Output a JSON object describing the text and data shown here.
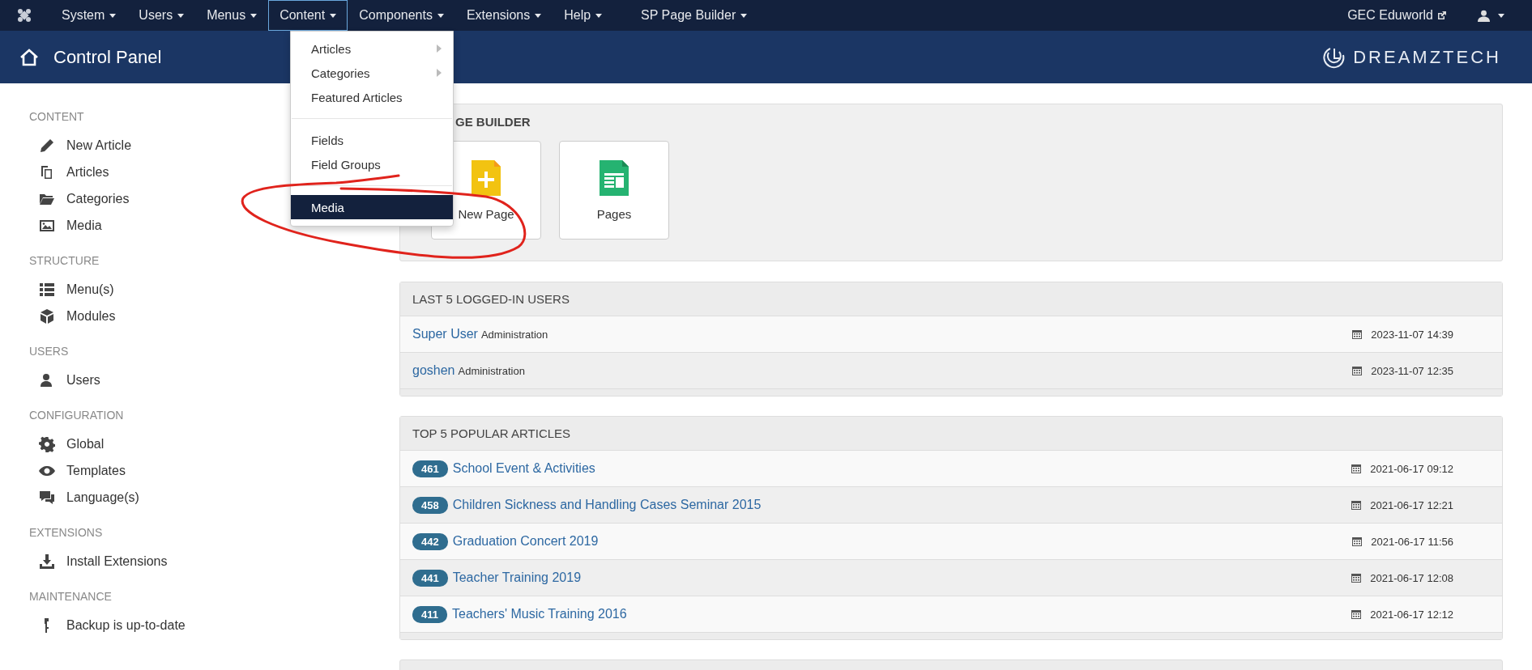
{
  "topbar": {
    "menus": [
      {
        "label": "System",
        "selected": false
      },
      {
        "label": "Users",
        "selected": false
      },
      {
        "label": "Menus",
        "selected": false
      },
      {
        "label": "Content",
        "selected": true
      },
      {
        "label": "Components",
        "selected": false
      },
      {
        "label": "Extensions",
        "selected": false
      },
      {
        "label": "Help",
        "selected": false
      },
      {
        "label": "SP Page Builder",
        "selected": false
      }
    ],
    "site_link": "GEC Eduworld"
  },
  "dropdown": {
    "items": [
      {
        "kind": "item",
        "label": "Articles",
        "submenu": true,
        "selected": false
      },
      {
        "kind": "item",
        "label": "Categories",
        "submenu": true,
        "selected": false
      },
      {
        "kind": "item",
        "label": "Featured Articles",
        "submenu": false,
        "selected": false
      },
      {
        "kind": "divider"
      },
      {
        "kind": "item",
        "label": "Fields",
        "submenu": false,
        "selected": false
      },
      {
        "kind": "item",
        "label": "Field Groups",
        "submenu": false,
        "selected": false
      },
      {
        "kind": "divider"
      },
      {
        "kind": "item",
        "label": "Media",
        "submenu": false,
        "selected": true
      }
    ]
  },
  "header": {
    "title": "Control Panel",
    "brand": "DREAMZTECH"
  },
  "sidebar": {
    "sections": [
      {
        "title": "CONTENT",
        "items": [
          "New Article",
          "Articles",
          "Categories",
          "Media"
        ]
      },
      {
        "title": "STRUCTURE",
        "items": [
          "Menu(s)",
          "Modules"
        ]
      },
      {
        "title": "USERS",
        "items": [
          "Users"
        ]
      },
      {
        "title": "CONFIGURATION",
        "items": [
          "Global",
          "Templates",
          "Language(s)"
        ]
      },
      {
        "title": "EXTENSIONS",
        "items": [
          "Install Extensions"
        ]
      },
      {
        "title": "MAINTENANCE",
        "items": [
          "Backup is up-to-date"
        ]
      }
    ]
  },
  "page_builder": {
    "title": "GE BUILDER",
    "tiles": [
      "New Page",
      "Pages"
    ]
  },
  "logged_in_users": {
    "title": "LAST 5 LOGGED-IN USERS",
    "rows": [
      {
        "name": "Super User",
        "role": "Administration",
        "date": "2023-11-07 14:39"
      },
      {
        "name": "goshen",
        "role": "Administration",
        "date": "2023-11-07 12:35"
      }
    ]
  },
  "popular_articles": {
    "title": "TOP 5 POPULAR ARTICLES",
    "rows": [
      {
        "hits": "461",
        "title": "School Event & Activities",
        "date": "2021-06-17 09:12"
      },
      {
        "hits": "458",
        "title": "Children Sickness and Handling Cases Seminar 2015",
        "date": "2021-06-17 12:21"
      },
      {
        "hits": "442",
        "title": "Graduation Concert 2019",
        "date": "2021-06-17 11:56"
      },
      {
        "hits": "441",
        "title": "Teacher Training 2019",
        "date": "2021-06-17 12:08"
      },
      {
        "hits": "411",
        "title": "Teachers' Music Training 2016",
        "date": "2021-06-17 12:12"
      }
    ]
  }
}
